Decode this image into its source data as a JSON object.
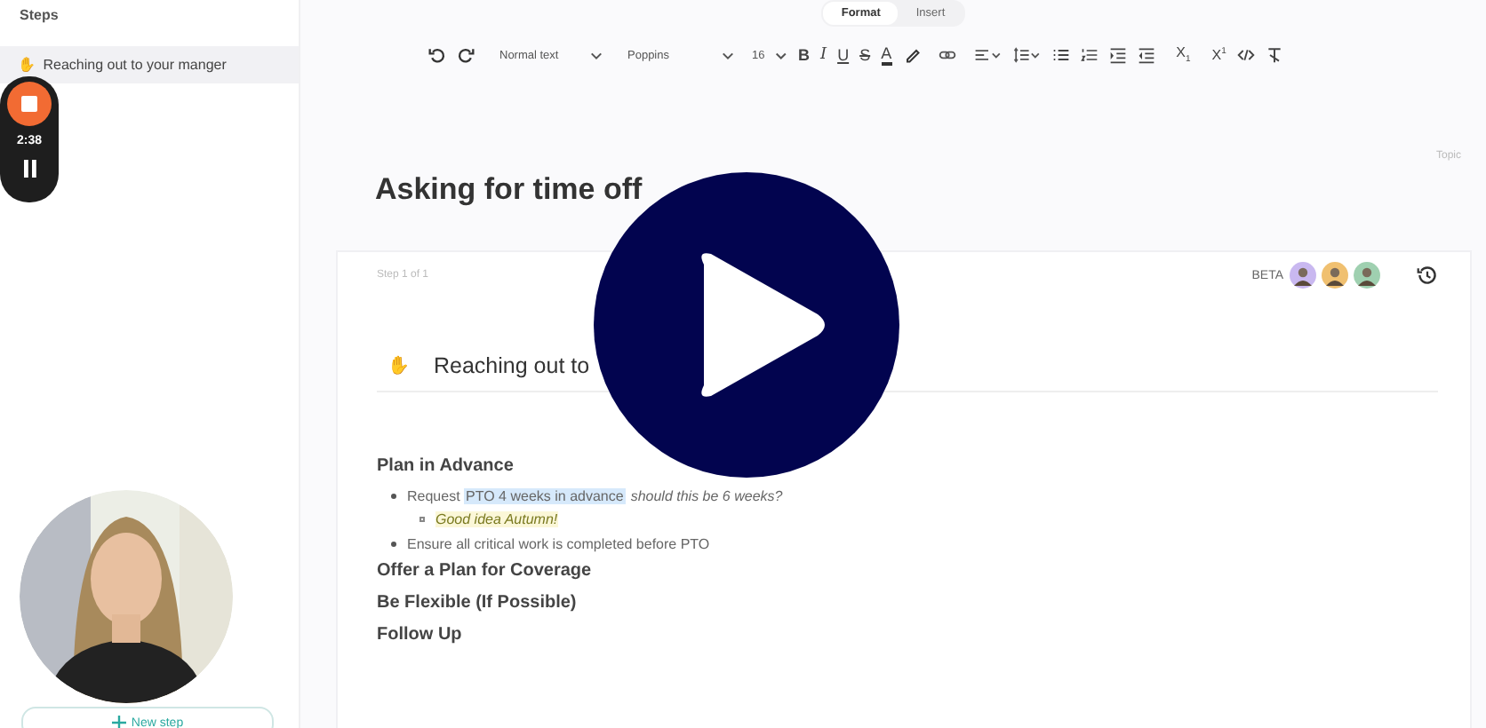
{
  "sidebar": {
    "title": "Steps",
    "items": [
      {
        "icon": "✋",
        "label": "Reaching out to your manger",
        "selected": true
      }
    ],
    "new_step": "New step"
  },
  "recorder": {
    "time": "2:38"
  },
  "mode_tabs": [
    {
      "label": "Format",
      "selected": true
    },
    {
      "label": "Insert",
      "selected": false
    }
  ],
  "toolbar": {
    "style": "Normal text",
    "font": "Poppins",
    "size": "16",
    "items": [
      {
        "kind": "bold",
        "glyph": "B"
      },
      {
        "kind": "italic",
        "glyph": "I"
      },
      {
        "kind": "underline",
        "glyph": "U"
      },
      {
        "kind": "strike",
        "glyph": "S"
      },
      {
        "kind": "color",
        "glyph": "A"
      },
      {
        "kind": "highlighter"
      },
      {
        "kind": "link"
      },
      {
        "kind": "align"
      },
      {
        "kind": "spacing"
      },
      {
        "kind": "bullets"
      },
      {
        "kind": "numbers"
      },
      {
        "kind": "indent"
      },
      {
        "kind": "outdent"
      },
      {
        "kind": "subscript",
        "glyph": "X",
        "small": "1"
      },
      {
        "kind": "superscript",
        "glyph": "X",
        "small": "1"
      },
      {
        "kind": "code"
      },
      {
        "kind": "clear"
      }
    ]
  },
  "topic": "Topic",
  "title": "Asking for time off",
  "step_counter": "Step 1 of 1",
  "beta": "BETA",
  "step": {
    "icon": "✋",
    "title": "Reaching out to"
  },
  "content": [
    {
      "kind": "heading",
      "text": "Plan in Advance"
    },
    {
      "kind": "bullet",
      "parts": [
        {
          "kind": "plain",
          "text": "Request "
        },
        {
          "kind": "highlight",
          "text": "PTO 4 weeks in advance"
        },
        {
          "kind": "comment",
          "text": "should this be 6 weeks?"
        }
      ],
      "children": [
        {
          "kind": "bullet",
          "parts": [
            {
              "kind": "note",
              "text": "Good idea Autumn!"
            }
          ]
        }
      ]
    },
    {
      "kind": "bullet",
      "parts": [
        {
          "kind": "plain",
          "text": "Ensure all critical work is completed before PTO"
        }
      ]
    },
    {
      "kind": "heading",
      "text": "Offer a Plan for Coverage"
    },
    {
      "kind": "heading",
      "text": "Be Flexible (If Possible)"
    },
    {
      "kind": "heading",
      "text": "Follow Up"
    }
  ]
}
